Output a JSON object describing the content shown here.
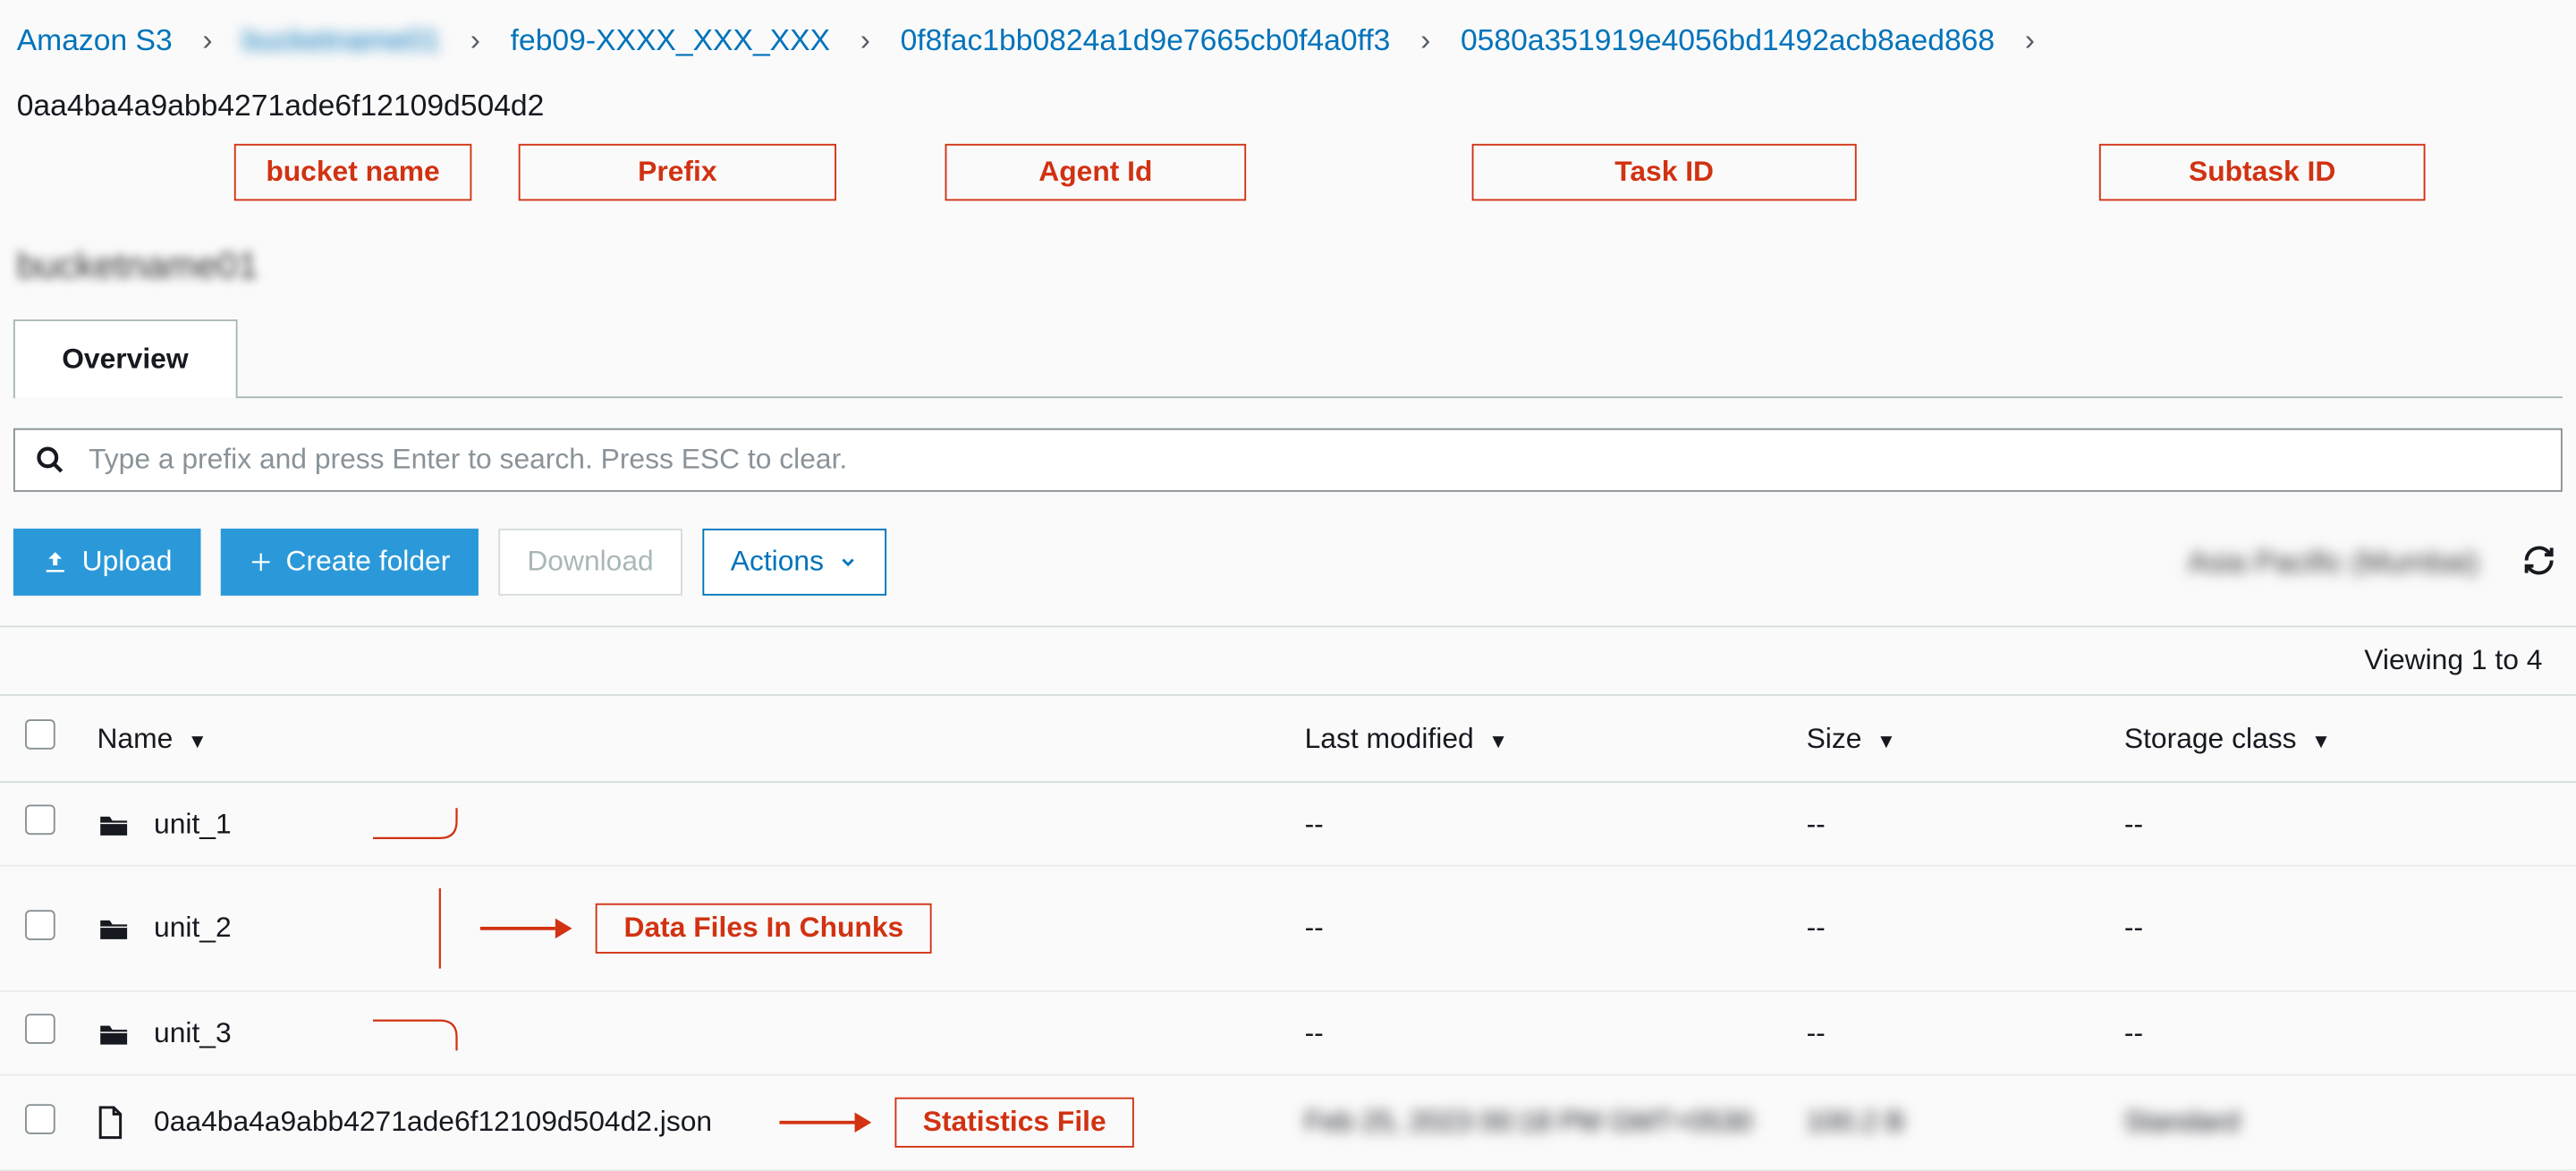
{
  "breadcrumb": {
    "root": "Amazon S3",
    "bucket": "bucketname01",
    "prefix": "feb09-XXXX_XXX_XXX",
    "agent_id": "0f8fac1bb0824a1d9e7665cb0f4a0ff3",
    "task_id": "0580a351919e4056bd1492acb8aed868",
    "subtask_id": "0aa4ba4a9abb4271ade6f12109d504d2"
  },
  "annotations": {
    "bucket": "bucket name",
    "prefix": "Prefix",
    "agent": "Agent Id",
    "task": "Task ID",
    "subtask": "Subtask ID",
    "chunks": "Data Files In Chunks",
    "stats": "Statistics File"
  },
  "page_title": "bucketname01",
  "tabs": {
    "overview": "Overview"
  },
  "search": {
    "placeholder": "Type a prefix and press Enter to search. Press ESC to clear."
  },
  "toolbar": {
    "upload": "Upload",
    "create_folder": "Create folder",
    "download": "Download",
    "actions": "Actions",
    "region": "Asia Pacific (Mumbai)"
  },
  "table": {
    "viewing": "Viewing 1 to 4",
    "headers": {
      "name": "Name",
      "last_modified": "Last modified",
      "size": "Size",
      "storage_class": "Storage class"
    },
    "rows": [
      {
        "type": "folder",
        "name": "unit_1",
        "last_modified": "--",
        "size": "--",
        "storage_class": "--"
      },
      {
        "type": "folder",
        "name": "unit_2",
        "last_modified": "--",
        "size": "--",
        "storage_class": "--"
      },
      {
        "type": "folder",
        "name": "unit_3",
        "last_modified": "--",
        "size": "--",
        "storage_class": "--"
      },
      {
        "type": "file",
        "name": "0aa4ba4a9abb4271ade6f12109d504d2.json",
        "last_modified": "Feb 25, 2023 00:18 PM GMT+0530",
        "size": "100.2 B",
        "storage_class": "Standard"
      }
    ]
  }
}
